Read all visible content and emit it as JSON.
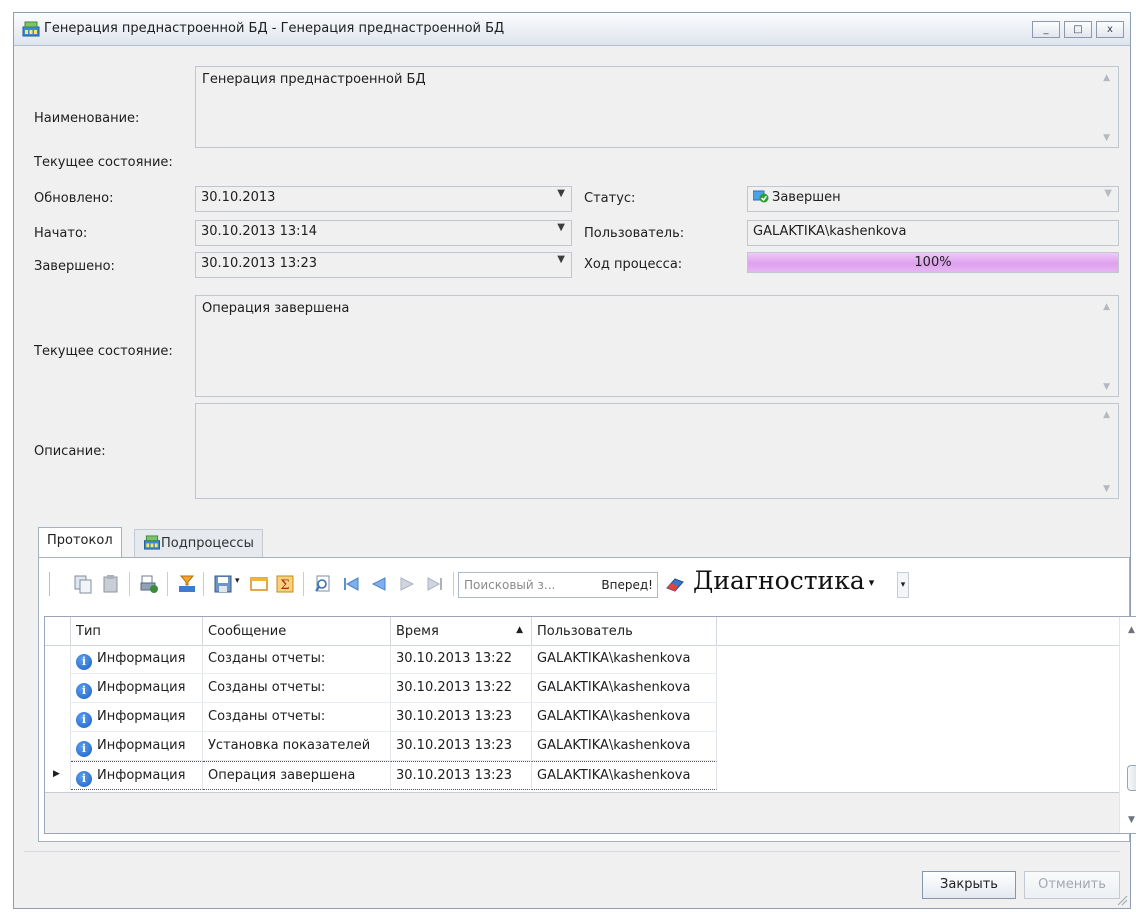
{
  "window": {
    "title": "Генерация преднастроенной БД - Генерация преднастроенной БД",
    "controls": {
      "minimize": "_",
      "maximize": "□",
      "close": "x"
    }
  },
  "form": {
    "name_label": "Наименование:",
    "name_value": "Генерация преднастроенной БД",
    "section_label": "Текущее состояние:",
    "updated_label": "Обновлено:",
    "updated_value": "30.10.2013",
    "started_label": "Начато:",
    "started_value": "30.10.2013 13:14",
    "finished_label": "Завершено:",
    "finished_value": "30.10.2013 13:23",
    "status_label": "Статус:",
    "status_value": "Завершен",
    "user_label": "Пользователь:",
    "user_value": "GALAKTIKA\\kashenkova",
    "progress_label": "Ход процесса:",
    "progress_text": "100%",
    "progress_fraction": 1.0,
    "state_label": "Текущее состояние:",
    "state_value": "Операция завершена",
    "description_label": "Описание:",
    "description_value": ""
  },
  "tabs": [
    {
      "label": "Протокол",
      "active": true
    },
    {
      "label": "Подпроцессы",
      "active": false
    }
  ],
  "toolbar": {
    "search_placeholder": "Поисковый з...",
    "search_go": "Вперед!",
    "diagnostics_label": "Диагностика",
    "dropdown_arrow": "▾"
  },
  "grid": {
    "columns": [
      "Тип",
      "Сообщение",
      "Время",
      "Пользователь"
    ],
    "sort_indicator": "▲",
    "rows": [
      {
        "type": "Информация",
        "message": "Созданы отчеты:",
        "time": "30.10.2013 13:22",
        "user": "GALAKTIKA\\kashenkova"
      },
      {
        "type": "Информация",
        "message": "Созданы отчеты:",
        "time": "30.10.2013 13:22",
        "user": "GALAKTIKA\\kashenkova"
      },
      {
        "type": "Информация",
        "message": "Созданы отчеты:",
        "time": "30.10.2013 13:23",
        "user": "GALAKTIKA\\kashenkova"
      },
      {
        "type": "Информация",
        "message": "Установка показателей",
        "time": "30.10.2013 13:23",
        "user": "GALAKTIKA\\kashenkova"
      },
      {
        "type": "Информация",
        "message": "Операция завершена",
        "time": "30.10.2013 13:23",
        "user": "GALAKTIKA\\kashenkova"
      }
    ],
    "selected_row": 4,
    "selected_marker": "▶",
    "info_glyph": "i"
  },
  "buttons": {
    "close": "Закрыть",
    "cancel": "Отменить"
  },
  "colors": {
    "progress_fill": "#dea0ee",
    "status_ok": "#2f9e35",
    "info_icon": "#1c5fc5"
  }
}
